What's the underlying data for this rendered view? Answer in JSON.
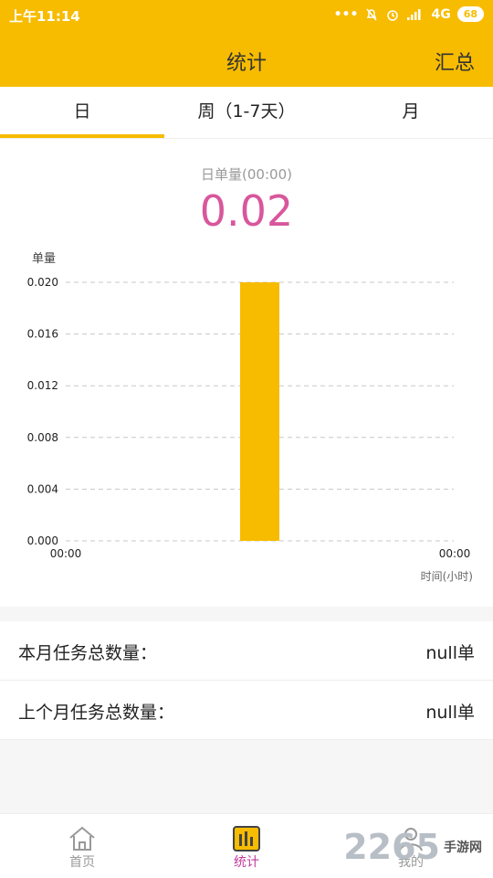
{
  "status_bar": {
    "time": "上午11:14",
    "network": "4G",
    "battery": "68",
    "icons": [
      "more-dots-icon",
      "mute-bell-icon",
      "alarm-icon",
      "signal-icon"
    ]
  },
  "header": {
    "title": "统计",
    "summary_button": "汇总"
  },
  "tabs": [
    {
      "label": "日",
      "active": true
    },
    {
      "label": "周（1-7天）",
      "active": false
    },
    {
      "label": "月",
      "active": false
    }
  ],
  "metric": {
    "label": "日单量(00:00)",
    "value": "0.02"
  },
  "chart_data": {
    "type": "bar",
    "ylabel": "单量",
    "xlabel": "时间(小时)",
    "categories": [
      "00:00",
      "00:00"
    ],
    "values": [
      0.02
    ],
    "ylim": [
      0,
      0.02
    ],
    "yticks": [
      "0.000",
      "0.004",
      "0.008",
      "0.012",
      "0.016",
      "0.020"
    ],
    "grid": true,
    "bar_color": "#f7bc00"
  },
  "list": [
    {
      "label": "本月任务总数量：",
      "value": "null单"
    },
    {
      "label": "上个月任务总数量：",
      "value": "null单"
    }
  ],
  "bottom_nav": [
    {
      "label": "首页",
      "icon": "home-icon",
      "active": false
    },
    {
      "label": "统计",
      "icon": "chart-icon",
      "active": true
    },
    {
      "label": "我的",
      "icon": "profile-icon",
      "active": false
    }
  ],
  "watermark": {
    "number": "2265",
    "text": "手游网"
  },
  "colors": {
    "brand": "#f7bc00",
    "metric": "#d8579c",
    "active_nav": "#c0399a"
  }
}
